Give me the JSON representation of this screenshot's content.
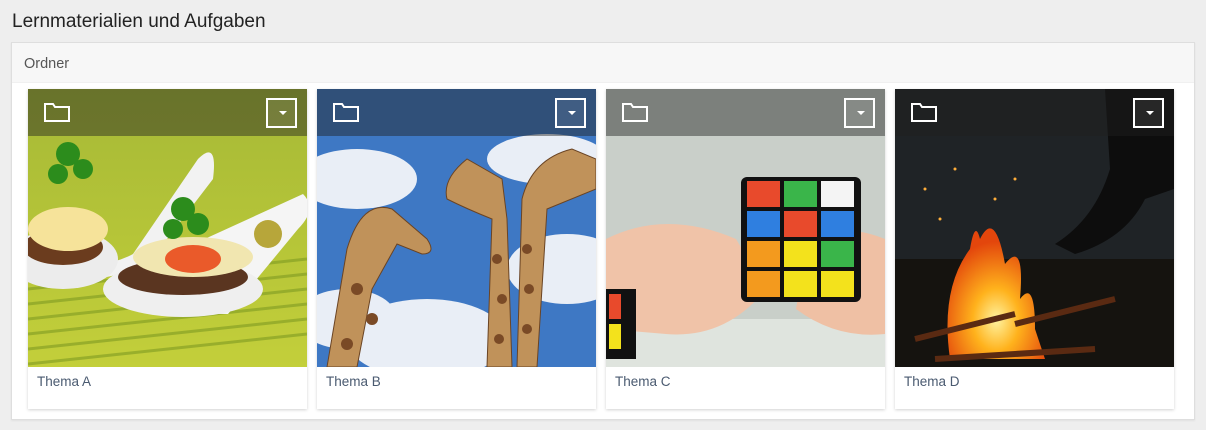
{
  "page": {
    "title": "Lernmaterialien und Aufgaben"
  },
  "panel": {
    "header": "Ordner"
  },
  "folders": [
    {
      "label": "Thema A",
      "icon": "folder-icon",
      "image": "appetizer-spoons-photo"
    },
    {
      "label": "Thema B",
      "icon": "folder-icon",
      "image": "giraffes-sky-photo"
    },
    {
      "label": "Thema C",
      "icon": "folder-icon",
      "image": "rubiks-cube-hands-photo"
    },
    {
      "label": "Thema D",
      "icon": "folder-icon",
      "image": "campfire-night-photo"
    }
  ],
  "colors": {
    "link": "#4a5a70",
    "panel_header_bg": "#f7f7f7",
    "page_bg": "#eeeeee"
  }
}
